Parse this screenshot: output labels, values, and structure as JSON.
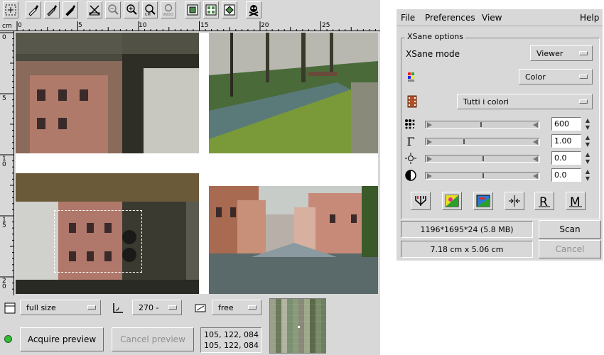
{
  "preview": {
    "ruler": {
      "unit": "cm",
      "top_labels": [
        "0",
        "5",
        "10",
        "15",
        "20",
        "25"
      ],
      "left_labels": [
        "0",
        "5",
        "10",
        "15",
        "20"
      ]
    },
    "toolbar_icons": [
      "select-area-icon",
      "white-point-eyedropper-icon",
      "gray-point-eyedropper-icon",
      "black-point-eyedropper-icon",
      "autoraise-icon",
      "zoom-out-icon",
      "zoom-in-icon",
      "zoom-area-icon",
      "zoom-undo-icon",
      "autoselect-icon",
      "full-area-icon",
      "delete-images-icon",
      "pirate-icon"
    ],
    "size_select": "full size",
    "rotation_select": "270 -",
    "ratio_select": "free",
    "acquire_label": "Acquire preview",
    "cancel_label": "Cancel preview",
    "readout_line1": "105, 122, 084",
    "readout_line2": "105, 122, 084",
    "status_color": "#2fbf2f"
  },
  "options": {
    "menu": {
      "file": "File",
      "preferences": "Preferences",
      "view": "View",
      "help": "Help"
    },
    "group_title": "XSane options",
    "mode_label": "XSane mode",
    "mode_value": "Viewer",
    "color_value": "Color",
    "medium_value": "Tutti i colori",
    "resolution": "600",
    "gamma": "1.00",
    "brightness": "0.0",
    "contrast": "0.0",
    "slider_levels": {
      "resolution": 0.48,
      "gamma": 0.3,
      "brightness": 0.5,
      "contrast": 0.5
    },
    "image_size": "1196*1695*24 (5.8 MB)",
    "dimensions": "7.18 cm x 5.06 cm",
    "scan_label": "Scan",
    "cancel_label": "Cancel"
  }
}
